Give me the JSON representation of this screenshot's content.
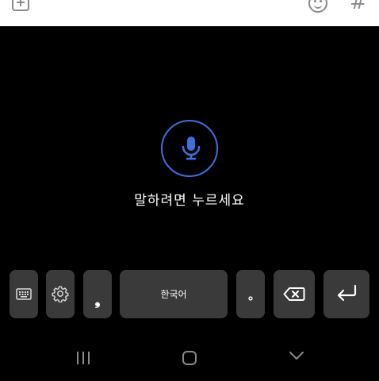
{
  "topbar": {
    "add_icon": "plus-square-icon",
    "emoji_icon": "smiley-icon",
    "hash_label": "#"
  },
  "voice": {
    "mic_icon": "microphone-icon",
    "accent_color": "#3d6fe0",
    "prompt": "말하려면 누르세요"
  },
  "keyboard": {
    "punct_left": "❟",
    "space_label": "한국어",
    "punct_right": "∘",
    "icons": [
      "keyboard-icon",
      "gear-icon",
      "backspace-icon",
      "enter-icon"
    ]
  },
  "navbar": {
    "icons": [
      "recent-apps-icon",
      "home-icon",
      "back-icon"
    ]
  }
}
